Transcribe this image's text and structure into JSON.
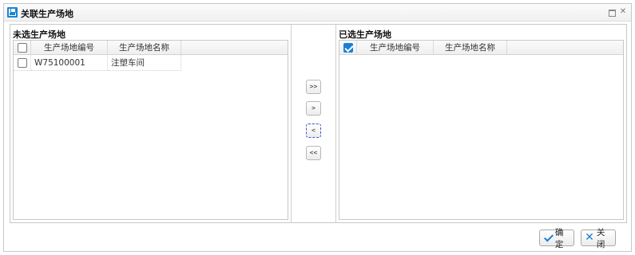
{
  "dialog": {
    "title": "关联生产场地"
  },
  "left_panel": {
    "title": "未选生产场地",
    "columns": {
      "code": "生产场地编号",
      "name": "生产场地名称"
    },
    "rows": [
      {
        "code": "W75100001",
        "name": "注塑车间",
        "checked": false
      }
    ],
    "header_checked": false
  },
  "right_panel": {
    "title": "已选生产场地",
    "columns": {
      "code": "生产场地编号",
      "name": "生产场地名称"
    },
    "rows": [],
    "header_checked": true
  },
  "move_buttons": {
    "all_right": ">>",
    "right": ">",
    "left": "<",
    "all_left": "<<"
  },
  "footer": {
    "ok_label": "确定",
    "close_label": "关闭"
  },
  "colors": {
    "accent": "#1a7fd8"
  }
}
